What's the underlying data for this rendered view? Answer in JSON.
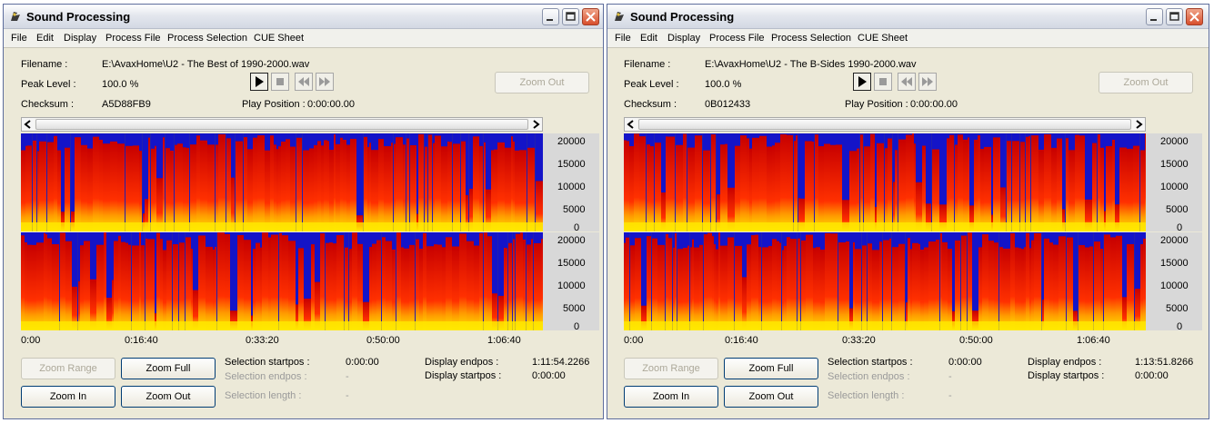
{
  "windows": [
    {
      "title": "Sound Processing",
      "menu": [
        "File",
        "Edit",
        "Display",
        "Process File",
        "Process Selection",
        "CUE Sheet"
      ],
      "filename_label": "Filename :",
      "filename": "E:\\AvaxHome\\U2 - The Best of 1990-2000.wav",
      "peak_label": "Peak Level :",
      "peak": "100.0 %",
      "checksum_label": "Checksum :",
      "checksum": "A5D88FB9",
      "play_position_label": "Play Position :",
      "play_position": "0:00:00.00",
      "zoom_out_top": "Zoom Out",
      "freq_ticks": [
        "20000",
        "15000",
        "10000",
        "5000",
        "0"
      ],
      "time_ticks": [
        "0:00",
        "0:16:40",
        "0:33:20",
        "0:50:00",
        "1:06:40"
      ],
      "zoom_range": "Zoom Range",
      "zoom_full": "Zoom Full",
      "zoom_in": "Zoom In",
      "zoom_out": "Zoom Out",
      "sel_start_label": "Selection startpos :",
      "sel_start": "0:00:00",
      "sel_end_label": "Selection endpos :",
      "sel_end": "-",
      "sel_len_label": "Selection length :",
      "sel_len": "-",
      "disp_end_label": "Display endpos :",
      "disp_end": "1:11:54.2266",
      "disp_start_label": "Display startpos :",
      "disp_start": "0:00:00"
    },
    {
      "title": "Sound Processing",
      "menu": [
        "File",
        "Edit",
        "Display",
        "Process File",
        "Process Selection",
        "CUE Sheet"
      ],
      "filename_label": "Filename :",
      "filename": "E:\\AvaxHome\\U2 - The B-Sides 1990-2000.wav",
      "peak_label": "Peak Level :",
      "peak": "100.0 %",
      "checksum_label": "Checksum :",
      "checksum": "0B012433",
      "play_position_label": "Play Position :",
      "play_position": "0:00:00.00",
      "zoom_out_top": "Zoom Out",
      "freq_ticks": [
        "20000",
        "15000",
        "10000",
        "5000",
        "0"
      ],
      "time_ticks": [
        "0:00",
        "0:16:40",
        "0:33:20",
        "0:50:00",
        "1:06:40"
      ],
      "zoom_range": "Zoom Range",
      "zoom_full": "Zoom Full",
      "zoom_in": "Zoom In",
      "zoom_out": "Zoom Out",
      "sel_start_label": "Selection startpos :",
      "sel_start": "0:00:00",
      "sel_end_label": "Selection endpos :",
      "sel_end": "-",
      "sel_len_label": "Selection length :",
      "sel_len": "-",
      "disp_end_label": "Display endpos :",
      "disp_end": "1:13:51.8266",
      "disp_start_label": "Display startpos :",
      "disp_start": "0:00:00"
    }
  ],
  "colors": {
    "spectrogram_low": "#ffe800",
    "spectrogram_mid": "#ff3000",
    "spectrogram_high": "#c80000",
    "spectrogram_quiet": "#1414c8"
  },
  "icons": [
    "app-icon",
    "minimize-icon",
    "maximize-icon",
    "close-icon",
    "play-icon",
    "stop-icon",
    "rewind-icon",
    "fast-forward-icon",
    "scroll-left-icon",
    "scroll-right-icon"
  ]
}
